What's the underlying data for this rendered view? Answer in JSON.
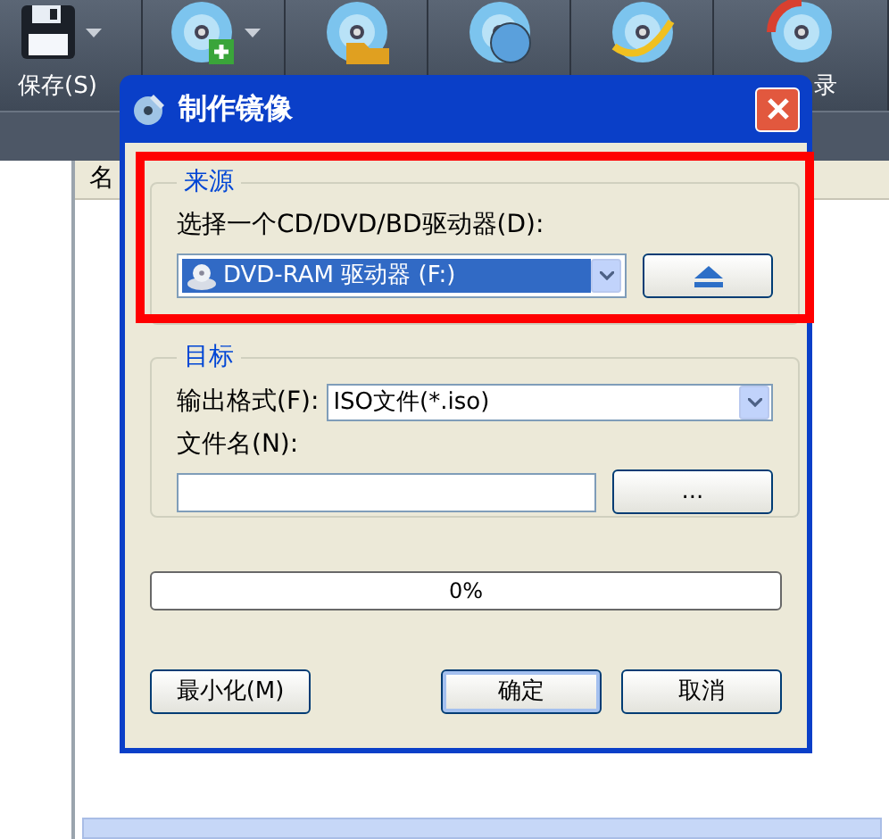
{
  "toolbar": {
    "items": [
      {
        "kind": "save",
        "label": "保存(S)",
        "dropdown": true
      },
      {
        "kind": "add",
        "dropdown": true
      },
      {
        "kind": "extract",
        "dropdown": false
      },
      {
        "kind": "make",
        "dropdown": false
      },
      {
        "kind": "convert",
        "dropdown": false
      },
      {
        "kind": "burn",
        "label": "录",
        "dropdown": false
      }
    ]
  },
  "file_list": {
    "column_1": "名"
  },
  "dialog": {
    "title": "制作镜像",
    "source": {
      "legend": "来源",
      "highlighted": true,
      "label": "选择一个CD/DVD/BD驱动器(D):",
      "drive": "DVD-RAM 驱动器 (F:)"
    },
    "target": {
      "legend": "目标",
      "format_label": "输出格式(F):",
      "format": "ISO文件(*.iso)",
      "filename_label": "文件名(N):",
      "browse": "..."
    },
    "progress": {
      "level": 0,
      "reading": "0%"
    },
    "buttons": [
      {
        "label": "最小化(M)",
        "kind": "left",
        "default": false
      },
      {
        "label": "确定",
        "kind": "right",
        "default": true
      },
      {
        "label": "取消",
        "kind": "right",
        "default": false
      }
    ]
  }
}
